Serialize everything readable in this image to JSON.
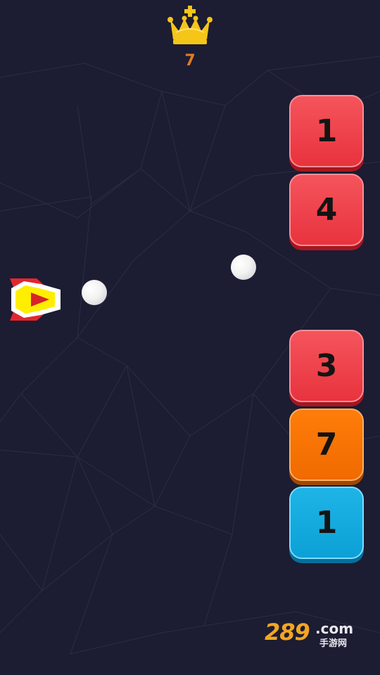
{
  "hud": {
    "crown_icon": "crown-icon",
    "best_score": "7"
  },
  "blocks": [
    {
      "value": "1",
      "color": "red"
    },
    {
      "value": "4",
      "color": "red"
    },
    {
      "value": "3",
      "color": "red"
    },
    {
      "value": "7",
      "color": "orange"
    },
    {
      "value": "1",
      "color": "blue"
    }
  ],
  "colors": {
    "background": "#1c1c32",
    "block_red": "#e8333e",
    "block_orange": "#f06a00",
    "block_blue": "#0ca1d6",
    "score": "#e07b20",
    "crown": "#f5c518"
  },
  "watermark": {
    "number": "289",
    "domain": ".com",
    "subtitle": "手游网"
  }
}
